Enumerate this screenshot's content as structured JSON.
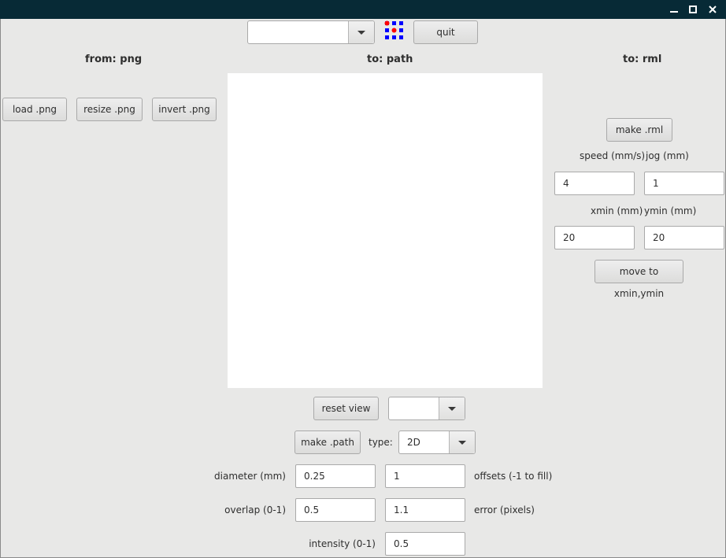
{
  "window": {
    "controls": {
      "minimize_icon": "minimize-icon",
      "maximize_icon": "maximize-icon",
      "close_icon": "close-icon"
    }
  },
  "top_bar": {
    "format_select_value": "",
    "logo_icon": "fab-logo-icon",
    "quit_label": "quit"
  },
  "columns": {
    "from_header": "from: png",
    "to_path_header": "to: path",
    "to_rml_header": "to: rml"
  },
  "png_panel": {
    "load_label": "load .png",
    "resize_label": "resize .png",
    "invert_label": "invert .png"
  },
  "rml_panel": {
    "make_label": "make .rml",
    "speed_label": "speed (mm/s)",
    "speed_value": "4",
    "jog_label": "jog (mm)",
    "jog_value": "1",
    "xmin_label": "xmin (mm)",
    "xmin_value": "20",
    "ymin_label": "ymin (mm)",
    "ymin_value": "20",
    "move_label": "move to xmin,ymin"
  },
  "path_panel": {
    "reset_view_label": "reset view",
    "view_select_value": "",
    "make_path_label": "make .path",
    "type_label": "type:",
    "type_value": "2D",
    "diameter_label": "diameter (mm)",
    "diameter_value": "0.25",
    "offsets_value": "1",
    "offsets_label": "offsets (-1 to fill)",
    "overlap_label": "overlap (0-1)",
    "overlap_value": "0.5",
    "error_value": "1.1",
    "error_label": "error (pixels)",
    "intensity_label": "intensity (0-1)",
    "intensity_value": "0.5"
  },
  "colors": {
    "titlebar": "#072a36",
    "window_bg": "#e8e8e7",
    "logo_blue": "#0000ff",
    "logo_red": "#ff0000"
  }
}
